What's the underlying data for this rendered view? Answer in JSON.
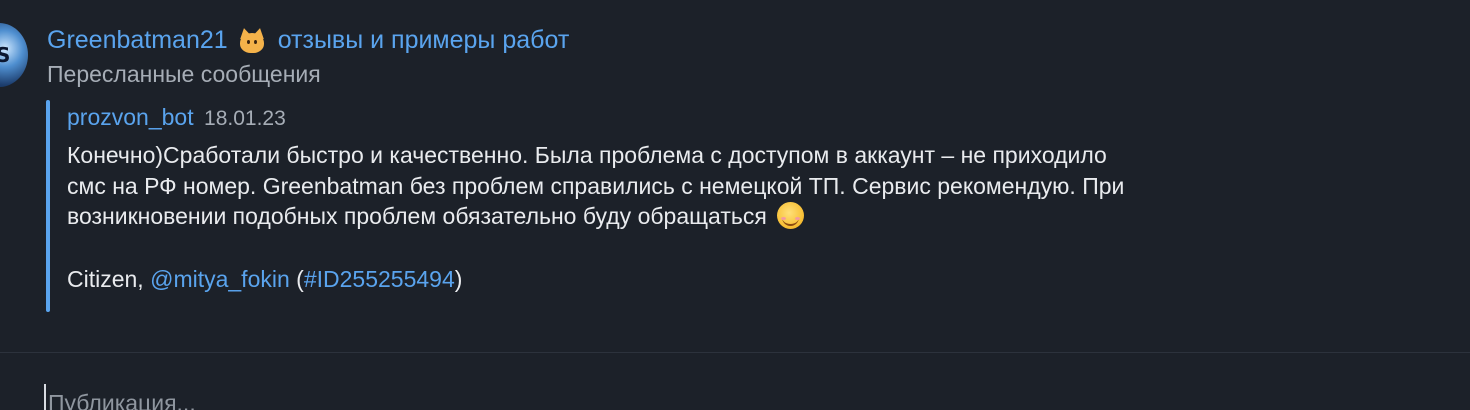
{
  "post": {
    "channel_name": "Greenbatman21",
    "channel_icon": "cat-face-icon",
    "channel_suffix": "отзывы и примеры работ",
    "subtitle": "Пересланные сообщения",
    "avatar_glyph": "S"
  },
  "forwarded": {
    "author": "prozvon_bot",
    "date": "18.01.23",
    "lines": [
      "Конечно)Сработали быстро и качественно. Была проблема с доступом в аккаунт – не приходило",
      "смс на РФ номер. Greenbatman без проблем справились с немецкой ТП. Сервис рекомендую. При",
      "возникновении подобных проблем обязательно буду обращаться"
    ],
    "emoji": "smiling-face-icon",
    "signature": {
      "prefix": "Citizen, ",
      "mention": "@mitya_fokin",
      "open": " (",
      "hashtag": "#ID255255494",
      "close": ")"
    }
  },
  "composer": {
    "placeholder": "Публикация..."
  },
  "colors": {
    "background": "#1c2129",
    "accent": "#5aa4ee",
    "text": "#e9ebee",
    "muted": "#a6adb6"
  }
}
